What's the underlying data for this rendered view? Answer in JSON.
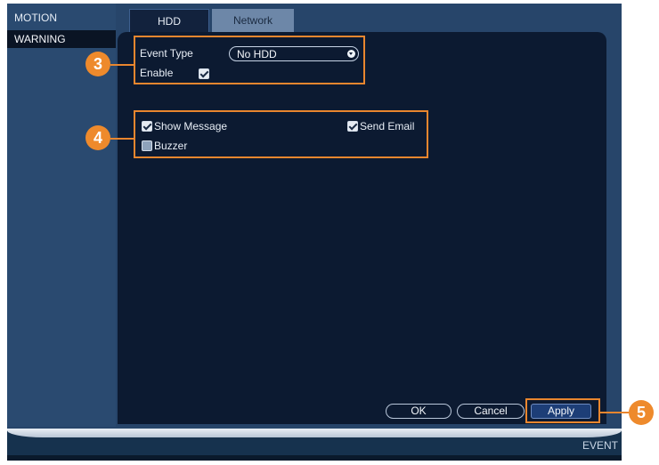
{
  "sidebar": {
    "items": [
      "MOTION",
      "WARNING"
    ]
  },
  "tabs": [
    "HDD",
    "Network"
  ],
  "form": {
    "event_type_label": "Event Type",
    "event_type_value": "No HDD",
    "enable_label": "Enable",
    "enable_checked": true,
    "show_message_label": "Show Message",
    "show_message_checked": true,
    "send_email_label": "Send Email",
    "send_email_checked": true,
    "buzzer_label": "Buzzer",
    "buzzer_checked": false
  },
  "buttons": {
    "ok": "OK",
    "cancel": "Cancel",
    "apply": "Apply"
  },
  "callouts": [
    "3",
    "4",
    "5"
  ],
  "status_bar": {
    "label": "EVENT"
  },
  "colors": {
    "accent": "#e9862e",
    "panel": "#0c1a31",
    "frame": "#27456a"
  },
  "icons": {
    "checkbox": "checkbox-icon",
    "dropdown": "dropdown-arrow-icon"
  }
}
